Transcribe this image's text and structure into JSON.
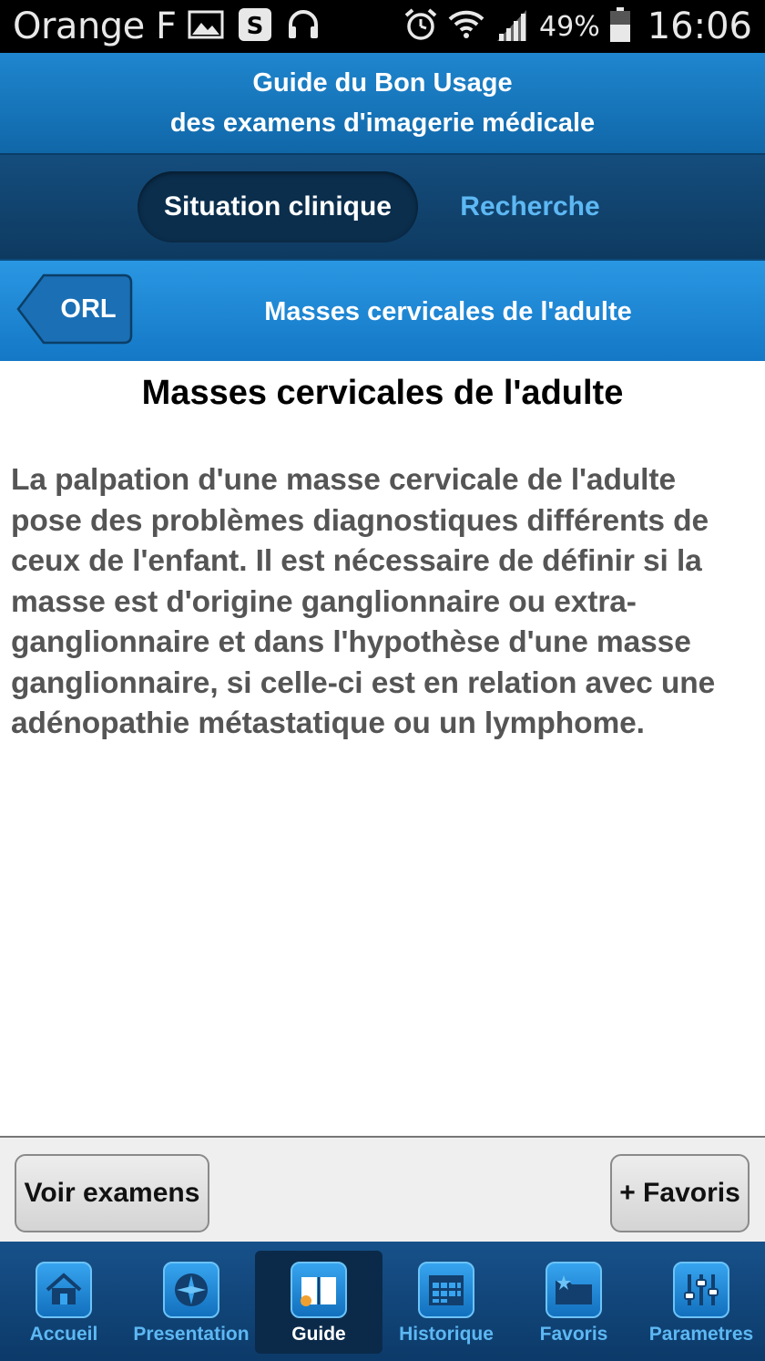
{
  "status_bar": {
    "carrier": "Orange F",
    "battery_percent": "49%",
    "time": "16:06",
    "icons_left": [
      "image-icon",
      "skype-icon",
      "headset-icon"
    ],
    "icons_right": [
      "alarm-icon",
      "wifi-icon",
      "signal-icon",
      "battery-icon"
    ]
  },
  "header": {
    "line1": "Guide du Bon Usage",
    "line2": "des examens d'imagerie médicale"
  },
  "tabs": [
    {
      "label": "Situation clinique",
      "active": true
    },
    {
      "label": "Recherche",
      "active": false
    }
  ],
  "nav": {
    "back_label": "ORL",
    "title": "Masses cervicales de l'adulte"
  },
  "content": {
    "title": "Masses cervicales de l'adulte",
    "body": "La palpation d'une masse cervicale de l'adulte pose des problèmes diagnostiques différents de ceux de l'enfant. Il est nécessaire de définir si la masse est d'origine ganglionnaire ou extra-ganglionnaire et dans l'hypothèse d'une masse ganglionnaire, si celle-ci est en relation avec une adénopathie métastatique ou un lymphome."
  },
  "actions": {
    "left_label": "Voir examens",
    "right_label": "+ Favoris"
  },
  "bottom_tabs": [
    {
      "label": "Accueil",
      "icon": "home-icon",
      "active": false
    },
    {
      "label": "Presentation",
      "icon": "compass-icon",
      "active": false
    },
    {
      "label": "Guide",
      "icon": "book-icon",
      "active": true
    },
    {
      "label": "Historique",
      "icon": "calendar-icon",
      "active": false
    },
    {
      "label": "Favoris",
      "icon": "folder-star-icon",
      "active": false
    },
    {
      "label": "Parametres",
      "icon": "sliders-icon",
      "active": false
    }
  ],
  "colors": {
    "header_blue": "#1a7bc2",
    "tab_bar_dark": "#0e3a60",
    "nav_blue": "#1f8ad8",
    "accent_light_blue": "#5db8f3",
    "body_text": "#555555"
  }
}
